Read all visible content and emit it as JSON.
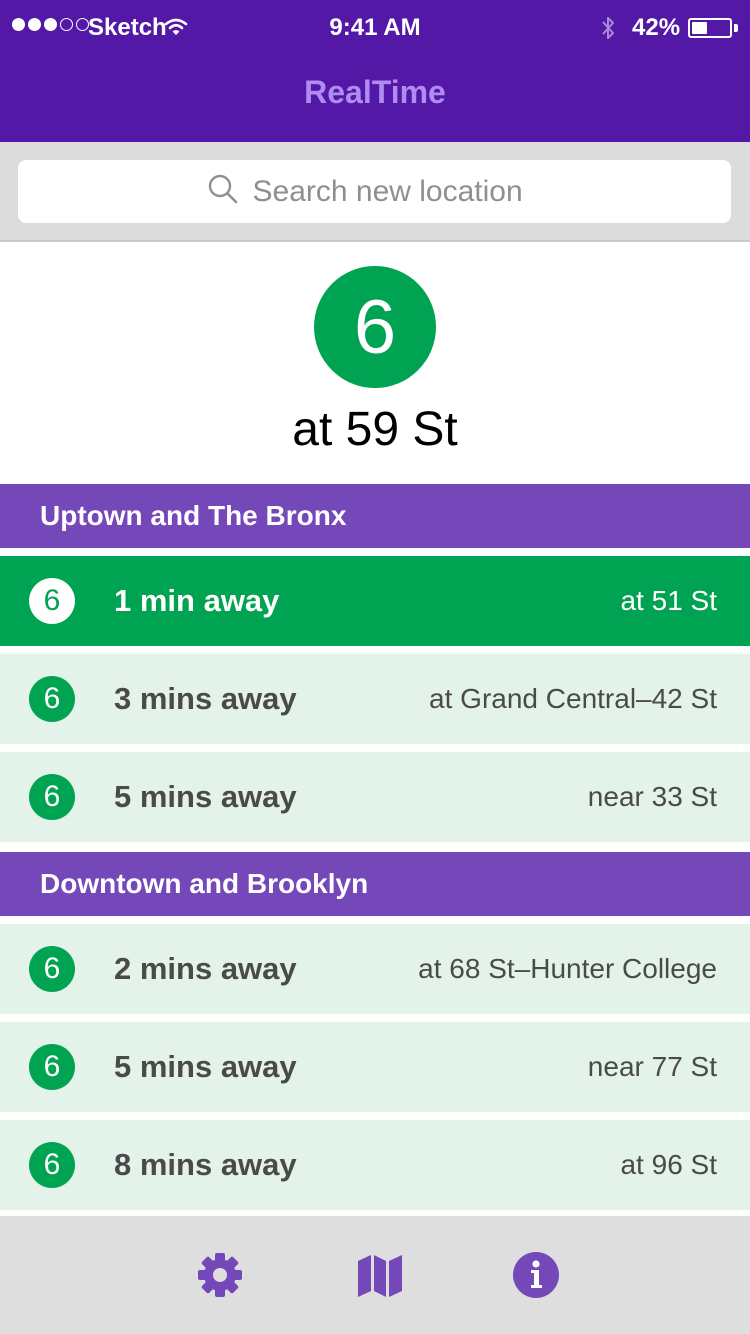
{
  "status_bar": {
    "carrier": "Sketch",
    "time": "9:41 AM",
    "battery_percent": "42%",
    "battery_level": 0.42,
    "signal_bars_filled": 3,
    "signal_bars_total": 5
  },
  "header": {
    "title": "RealTime"
  },
  "search": {
    "placeholder": "Search new location",
    "value": ""
  },
  "station": {
    "line": "6",
    "name": "at 59 St"
  },
  "sections": [
    {
      "title": "Uptown and The Bronx",
      "arrivals": [
        {
          "line": "6",
          "eta": "1 min away",
          "location": "at 51 St",
          "highlighted": true
        },
        {
          "line": "6",
          "eta": "3 mins away",
          "location": "at Grand Central–42 St",
          "highlighted": false
        },
        {
          "line": "6",
          "eta": "5 mins away",
          "location": "near 33 St",
          "highlighted": false
        }
      ]
    },
    {
      "title": "Downtown and Brooklyn",
      "arrivals": [
        {
          "line": "6",
          "eta": "2 mins away",
          "location": "at 68 St–Hunter College",
          "highlighted": false
        },
        {
          "line": "6",
          "eta": "5 mins away",
          "location": "near 77 St",
          "highlighted": false
        },
        {
          "line": "6",
          "eta": "8 mins away",
          "location": "at 96 St",
          "highlighted": false
        }
      ]
    }
  ],
  "tabbar": {
    "items": [
      {
        "icon": "gear-icon"
      },
      {
        "icon": "map-icon"
      },
      {
        "icon": "info-icon"
      }
    ]
  },
  "colors": {
    "header_bg": "#5319A6",
    "title_text": "#B08CF2",
    "section_header_bg": "#7448B9",
    "line_6_green": "#00A352",
    "row_bg": "#E3F3EA",
    "tab_icon": "#7448B9"
  }
}
